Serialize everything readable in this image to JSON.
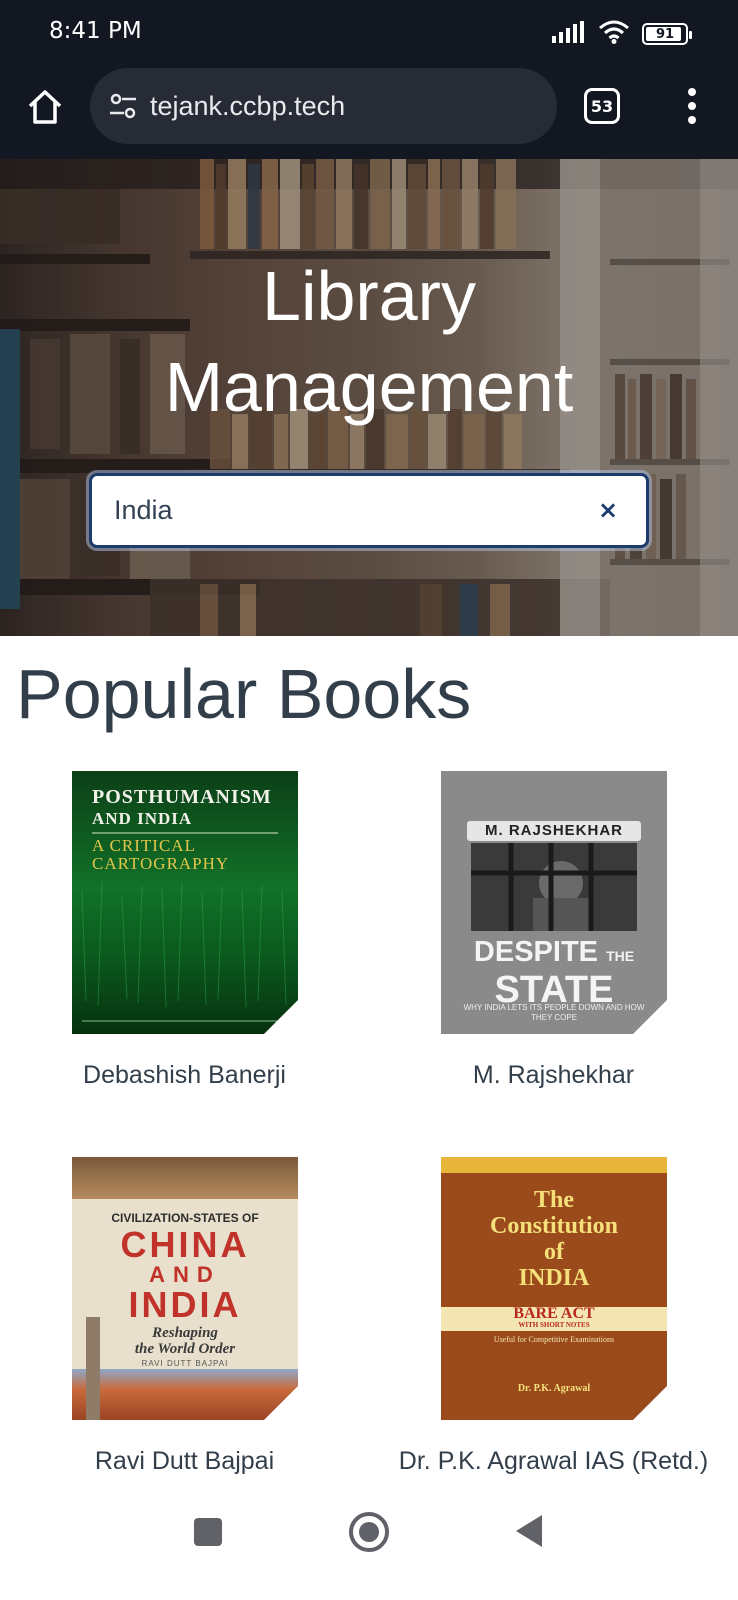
{
  "status_bar": {
    "time": "8:41 PM",
    "battery": "91",
    "battery_level_percent": 91,
    "icons": [
      "signal-icon",
      "wifi-icon",
      "battery-icon"
    ]
  },
  "browser": {
    "url": "tejank.ccbp.tech",
    "tab_count": "53",
    "icons": [
      "home-icon",
      "site-settings-icon",
      "tabs-icon",
      "more-menu-icon"
    ]
  },
  "hero": {
    "title_line1": "Library",
    "title_line2": "Management",
    "search": {
      "value": "India",
      "clear_label": "×"
    }
  },
  "popular": {
    "title": "Popular Books",
    "books": [
      {
        "author": "Debashish Banerji",
        "cover_title_1": "POSTHUMANISM",
        "cover_title_2": "AND INDIA",
        "cover_subtitle_1": "A CRITICAL",
        "cover_subtitle_2": "CARTOGRAPHY"
      },
      {
        "author": "M. Rajshekhar",
        "cover_author": "M. RAJSHEKHAR",
        "cover_title_1": "DESPITE",
        "cover_title_the": "THE",
        "cover_title_2": "STATE",
        "cover_tagline": "WHY INDIA LETS ITS PEOPLE DOWN AND HOW THEY COPE"
      },
      {
        "author": "Ravi Dutt Bajpai",
        "cover_kicker": "CIVILIZATION-STATES OF",
        "cover_title_1": "CHINA",
        "cover_title_and": "AND",
        "cover_title_2": "INDIA",
        "cover_subtitle_1": "Reshaping",
        "cover_subtitle_2": "the World Order",
        "cover_author": "RAVI DUTT BAJPAI"
      },
      {
        "author": "Dr. P.K. Agrawal IAS (Retd.)",
        "cover_title_1": "The",
        "cover_title_2": "Constitution",
        "cover_title_3": "of",
        "cover_title_4": "INDIA",
        "cover_band_1": "BARE ACT",
        "cover_band_2": "WITH SHORT NOTES",
        "cover_note": "Useful for Competitive Examinations",
        "cover_author": "Dr. P.K. Agrawal"
      }
    ]
  },
  "nav": {
    "icons": [
      "recents-icon",
      "home-circle-icon",
      "back-icon"
    ]
  },
  "colors": {
    "status_bg": "#131722",
    "url_pill": "#262b36",
    "title_text": "#323f4b",
    "search_border": "#1d3b6c"
  }
}
